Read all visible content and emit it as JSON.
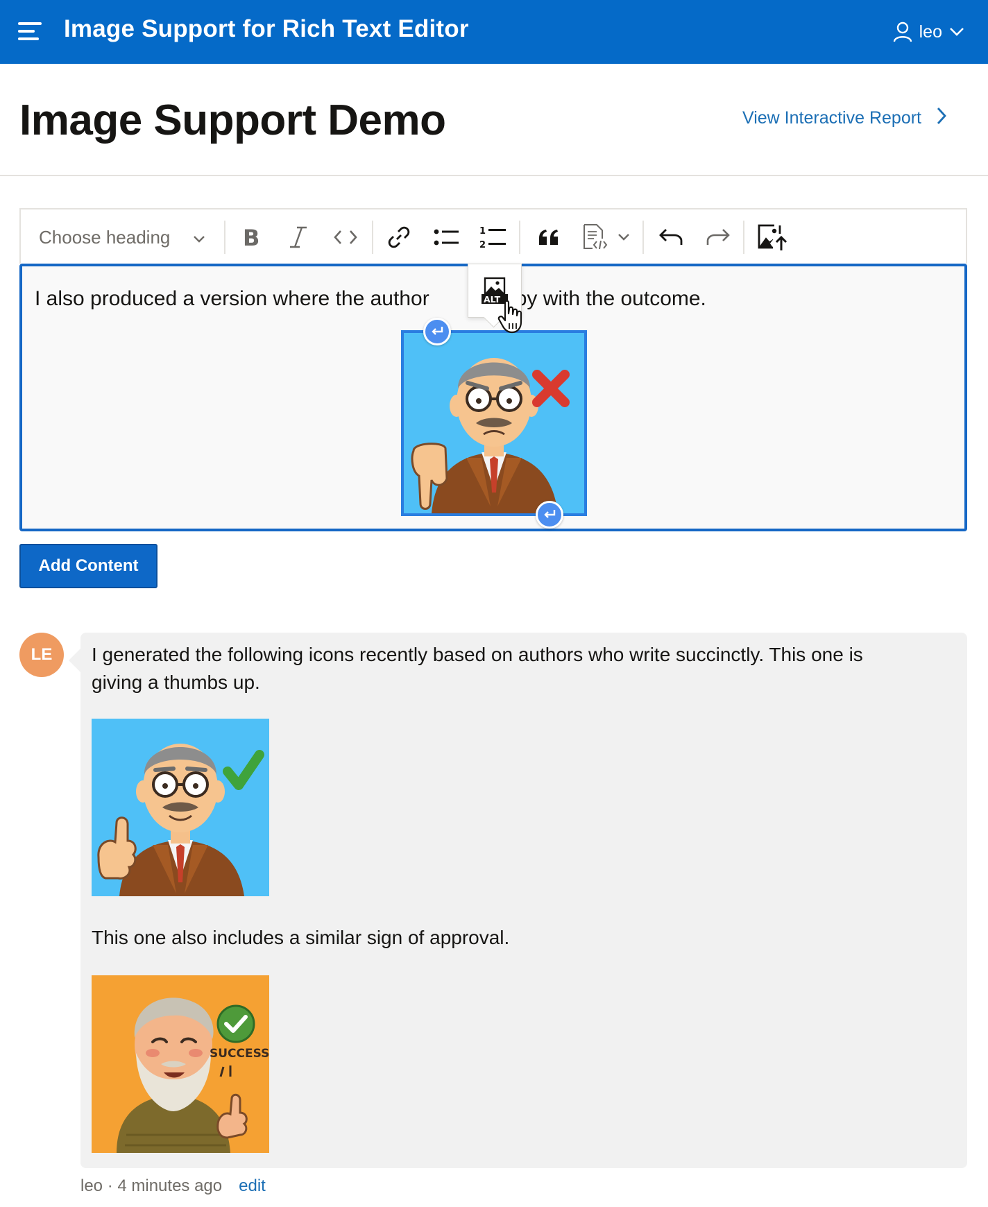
{
  "header": {
    "app_title": "Image Support for Rich Text Editor",
    "user_name": "leo",
    "background_color": "#056ac8"
  },
  "page": {
    "title": "Image Support Demo",
    "report_link": "View Interactive Report"
  },
  "toolbar": {
    "heading_placeholder": "Choose heading",
    "buttons": [
      "bold-icon",
      "italic-icon",
      "code-icon",
      "link-icon",
      "bulleted-list-icon",
      "numbered-list-icon",
      "block-quote-icon",
      "code-block-icon",
      "undo-icon",
      "redo-icon",
      "insert-image-icon"
    ]
  },
  "editor": {
    "text_before": "I also produced a version where the author",
    "text_after": "happy with the outcome.",
    "image_icon": "author-thumbs-down-image",
    "balloon_icon": "alt-text-icon",
    "focus_color": "#1567c5"
  },
  "actions": {
    "add_content_label": "Add Content",
    "button_color": "#0e68c7"
  },
  "comment": {
    "avatar_initials": "LE",
    "avatar_color": "#ef9b61",
    "paragraph_1": "I generated the following icons recently based on authors who write succinctly. This one is giving a thumbs up.",
    "paragraph_2": "This one also includes a similar sign of approval.",
    "image_1_icon": "author-thumbs-up-image",
    "image_2_icon": "author-success-image",
    "image_2_caption": "SUCCESS!",
    "author": "leo",
    "separator": " · ",
    "time_ago": "4 minutes ago",
    "edit_label": "edit"
  }
}
